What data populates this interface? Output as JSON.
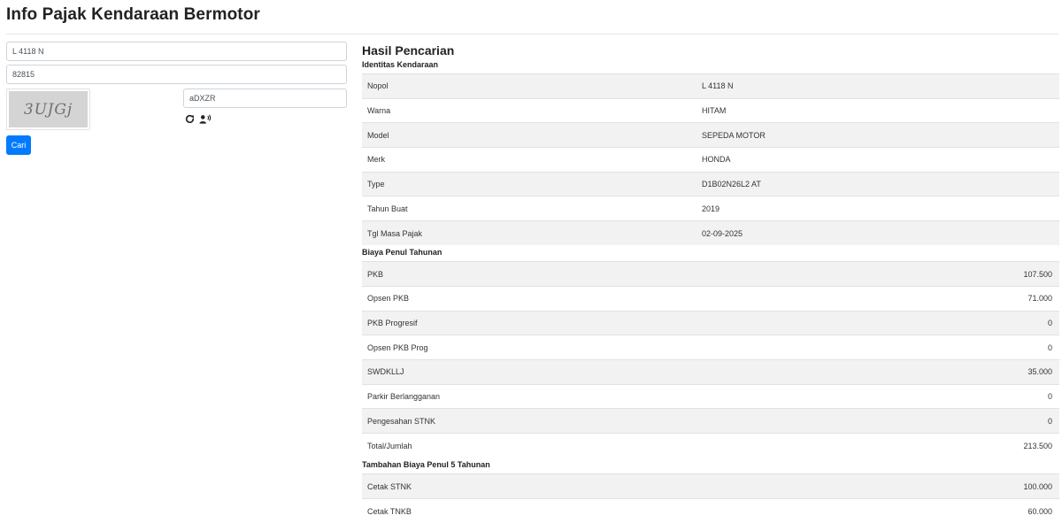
{
  "header": {
    "title": "Info Pajak Kendaraan Bermotor"
  },
  "form": {
    "nopol_value": "L 4118 N",
    "kode_value": "82815",
    "captcha_text": "3UJGj",
    "captcha_input_value": "aDXZR",
    "refresh_icon": "refresh-icon",
    "audio_icon": "audio-captcha-icon",
    "submit_label": "Cari"
  },
  "results": {
    "title": "Hasil Pencarian",
    "identitas": {
      "title": "Identitas Kendaraan",
      "rows": [
        {
          "label": "Nopol",
          "value": "L 4118 N"
        },
        {
          "label": "Warna",
          "value": "HITAM"
        },
        {
          "label": "Model",
          "value": "SEPEDA MOTOR"
        },
        {
          "label": "Merk",
          "value": "HONDA"
        },
        {
          "label": "Type",
          "value": "D1B02N26L2 AT"
        },
        {
          "label": "Tahun Buat",
          "value": "2019"
        },
        {
          "label": "Tgl Masa Pajak",
          "value": "02-09-2025"
        }
      ]
    },
    "biaya": {
      "title": "Biaya Penul Tahunan",
      "rows": [
        {
          "label": "PKB",
          "value": "107.500"
        },
        {
          "label": "Opsen PKB",
          "value": "71.000"
        },
        {
          "label": "PKB Progresif",
          "value": "0"
        },
        {
          "label": "Opsen PKB Prog",
          "value": "0"
        },
        {
          "label": "SWDKLLJ",
          "value": "35.000"
        },
        {
          "label": "Parkir Berlangganan",
          "value": "0"
        },
        {
          "label": "Pengesahan STNK",
          "value": "0"
        },
        {
          "label": "Total/Jumlah",
          "value": "213.500"
        }
      ]
    },
    "tambahan": {
      "title": "Tambahan Biaya Penul 5 Tahunan",
      "rows": [
        {
          "label": "Cetak STNK",
          "value": "100.000"
        },
        {
          "label": "Cetak TNKB",
          "value": "60.000"
        }
      ]
    }
  },
  "colors": {
    "primary": "#007bff",
    "stripe": "#f2f2f2",
    "border": "#dee2e6"
  }
}
